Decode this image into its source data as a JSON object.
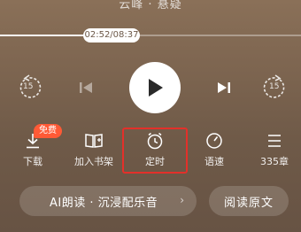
{
  "header": {
    "title": "云峰 · 悬疑"
  },
  "playback": {
    "time_label": "02:52/08:37",
    "progress_fraction": 0.333,
    "rewind_seconds": "15",
    "forward_seconds": "15"
  },
  "menu": {
    "free_badge": "免费",
    "items": [
      {
        "label": "下载",
        "icon": "download-icon"
      },
      {
        "label": "加入书架",
        "icon": "bookshelf-icon"
      },
      {
        "label": "定时",
        "icon": "timer-icon"
      },
      {
        "label": "语速",
        "icon": "speed-icon"
      },
      {
        "label": "335章",
        "icon": "chapter-list-icon"
      }
    ]
  },
  "bottom": {
    "ai_label": "AI朗读 · 沉浸配乐音",
    "chevron": "›",
    "original_label": "阅读原文"
  },
  "colors": {
    "badge": "#ff5a36",
    "highlight": "#e3302a"
  }
}
